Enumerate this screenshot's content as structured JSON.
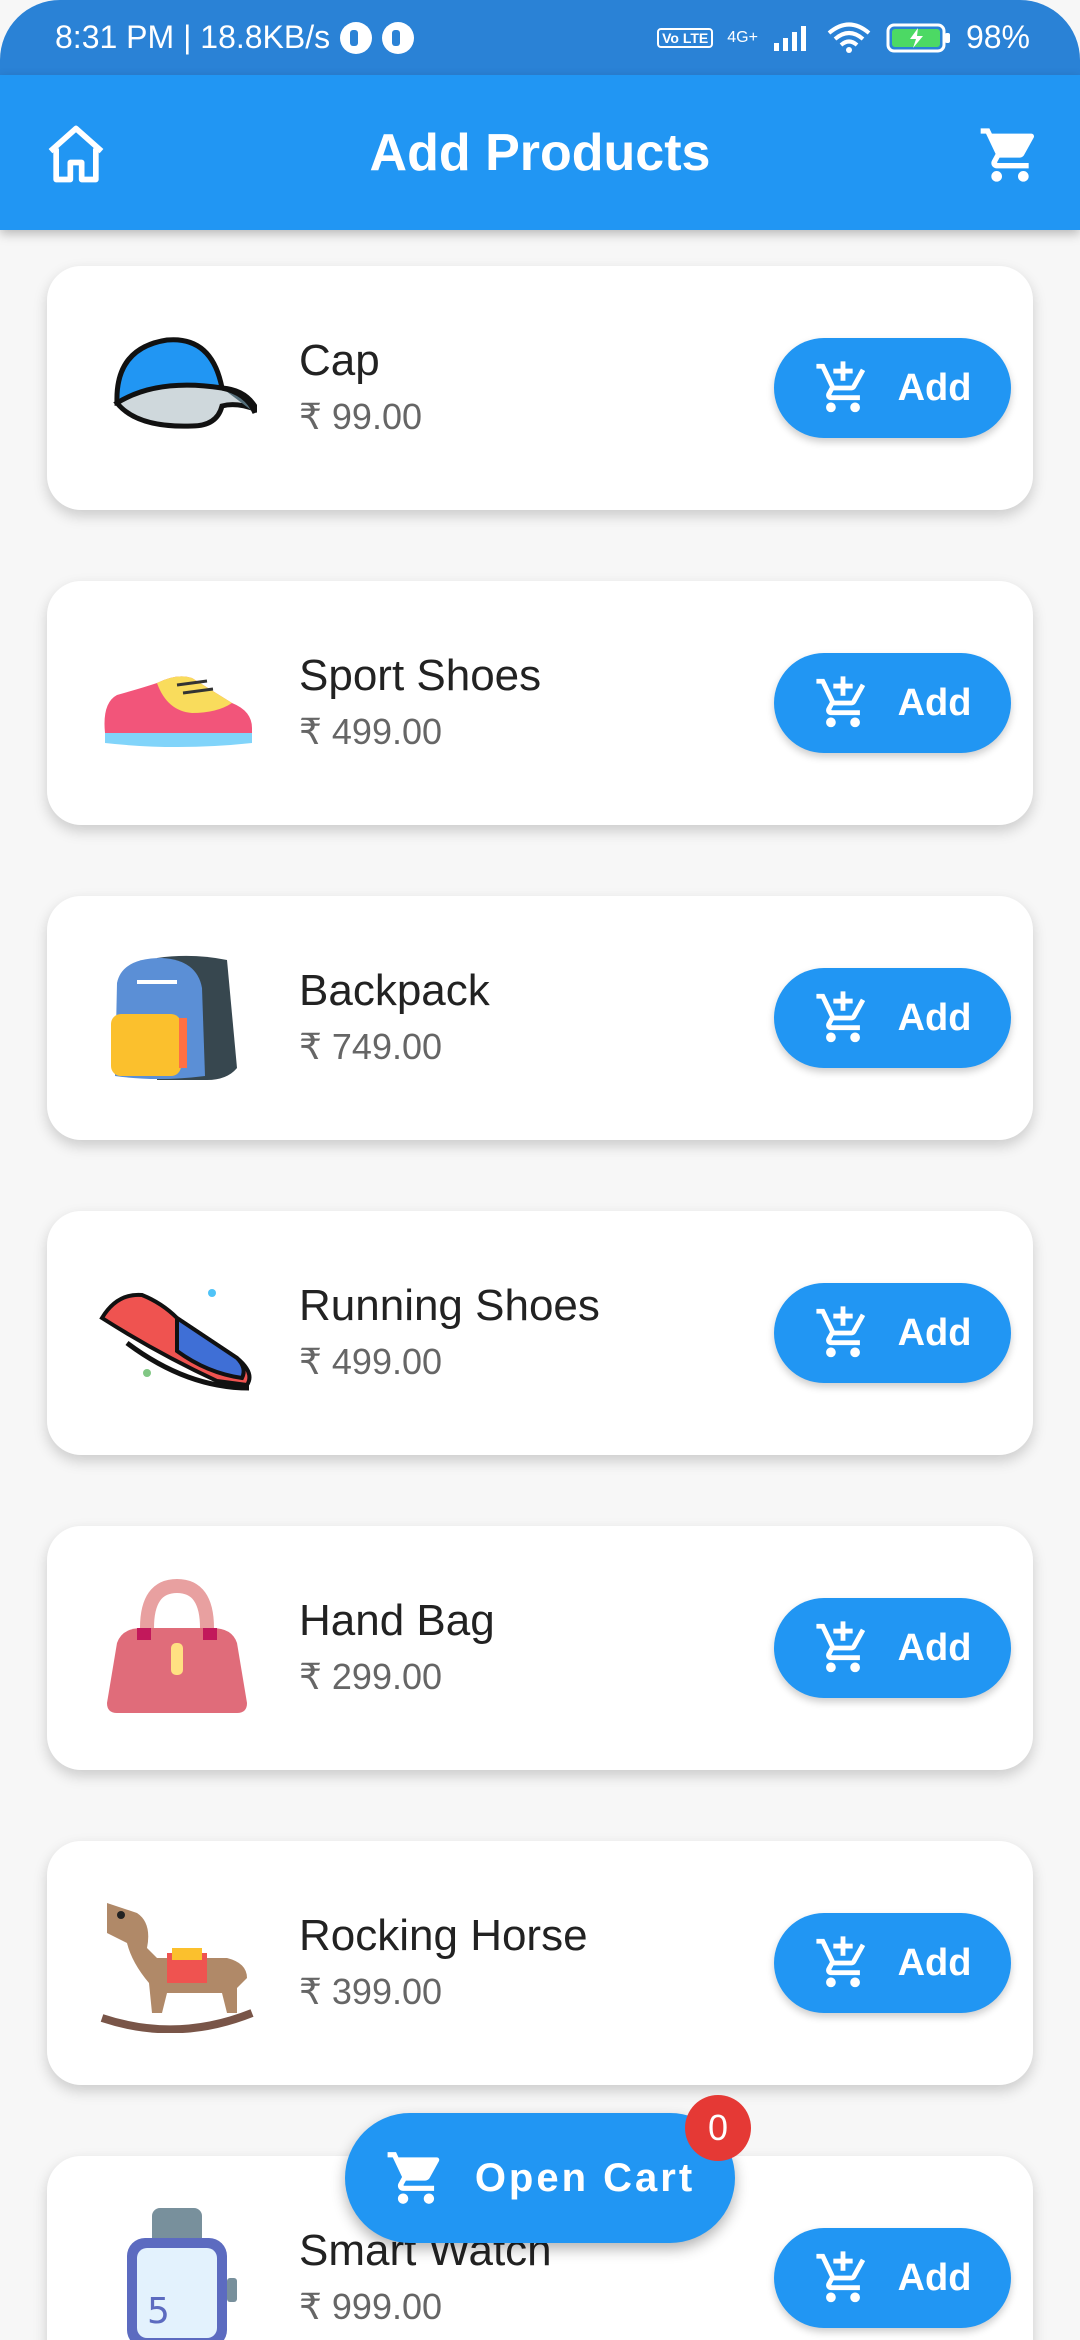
{
  "status_bar": {
    "time_speed": "8:31 PM | 18.8KB/s",
    "volte": "Vo LTE",
    "network": "4G+",
    "battery": "98%"
  },
  "app_bar": {
    "title": "Add Products",
    "home_icon": "home-icon",
    "cart_icon": "cart-icon"
  },
  "products": [
    {
      "name": "Cap",
      "price": "₹ 99.00",
      "button": "Add"
    },
    {
      "name": "Sport Shoes",
      "price": "₹ 499.00",
      "button": "Add"
    },
    {
      "name": "Backpack",
      "price": "₹ 749.00",
      "button": "Add"
    },
    {
      "name": "Running Shoes",
      "price": "₹ 499.00",
      "button": "Add"
    },
    {
      "name": "Hand Bag",
      "price": "₹ 299.00",
      "button": "Add"
    },
    {
      "name": "Rocking Horse",
      "price": "₹ 399.00",
      "button": "Add"
    },
    {
      "name": "Smart Watch",
      "price": "₹ 999.00",
      "button": "Add"
    }
  ],
  "fab": {
    "label": "Open Cart",
    "badge_count": "0"
  },
  "colors": {
    "primary": "#2196f3",
    "status_bar": "#2a82d6",
    "badge": "#e53935"
  }
}
